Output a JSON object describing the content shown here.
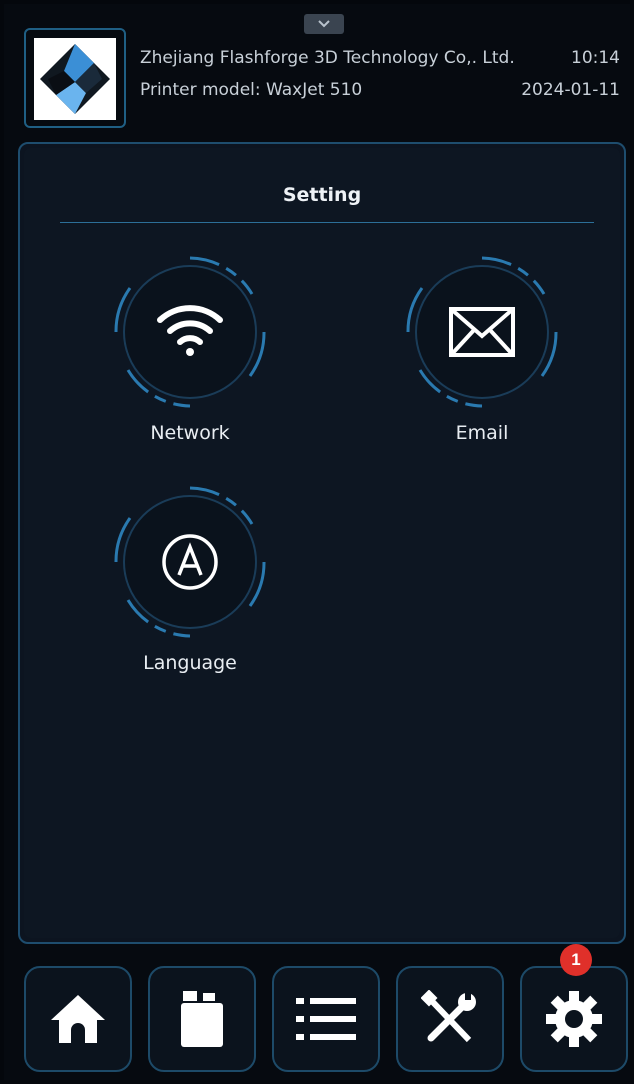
{
  "header": {
    "company": "Zhejiang Flashforge 3D Technology Co,. Ltd.",
    "time": "10:14",
    "printer_model": "Printer model: WaxJet 510",
    "date": "2024-01-11"
  },
  "panel": {
    "title": "Setting",
    "items": [
      {
        "label": "Network",
        "icon": "wifi-icon"
      },
      {
        "label": "Email",
        "icon": "envelope-icon"
      },
      {
        "label": "Language",
        "icon": "language-a-icon"
      }
    ]
  },
  "nav": {
    "items": [
      {
        "icon": "home-icon"
      },
      {
        "icon": "material-bottle-icon"
      },
      {
        "icon": "list-icon"
      },
      {
        "icon": "tools-icon"
      },
      {
        "icon": "gear-icon",
        "active": true
      }
    ],
    "badge": "1"
  },
  "colors": {
    "background": "#060a10",
    "panel": "#0d1622",
    "accent": "#2a7ab0",
    "badge": "#e0302a"
  }
}
